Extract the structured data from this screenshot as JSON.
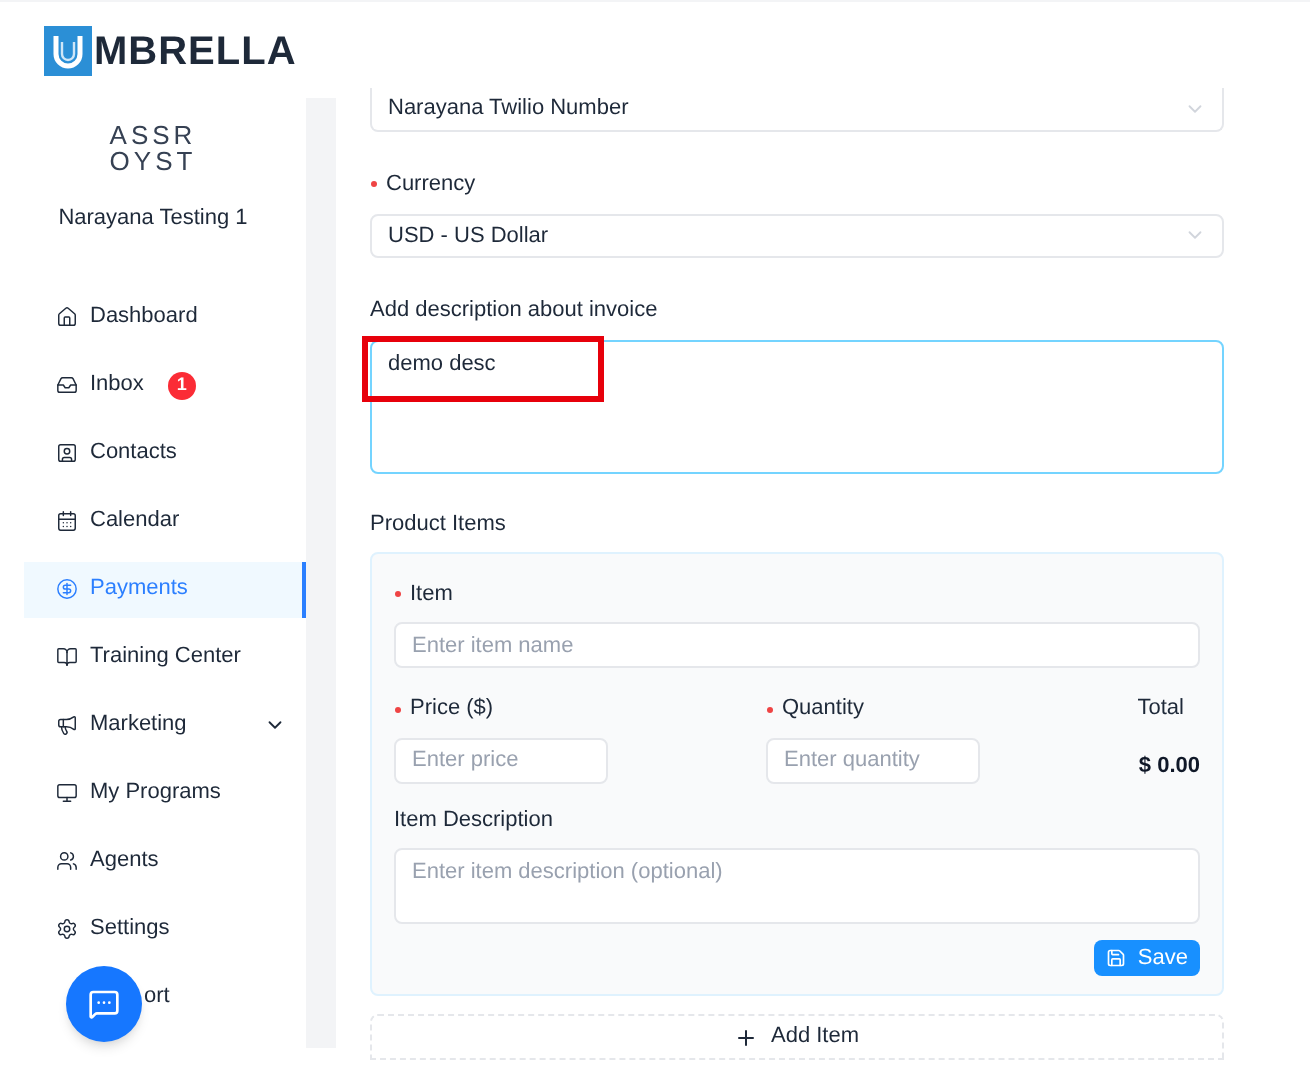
{
  "brand": {
    "name": "MBRELLA"
  },
  "account": {
    "logo_lines": [
      "ASSR",
      "OYST"
    ],
    "name": "Narayana Testing 1"
  },
  "sidebar": {
    "items": [
      {
        "label": "Dashboard",
        "kind": "link",
        "selected": false
      },
      {
        "label": "Inbox",
        "kind": "link",
        "selected": false,
        "badge": "1"
      },
      {
        "label": "Contacts",
        "kind": "link",
        "selected": false
      },
      {
        "label": "Calendar",
        "kind": "link",
        "selected": false
      },
      {
        "label": "Payments",
        "kind": "link",
        "selected": true
      },
      {
        "label": "Training Center",
        "kind": "link",
        "selected": false
      },
      {
        "label": "Marketing",
        "kind": "link",
        "selected": false,
        "expandable": true
      },
      {
        "label": "My Programs",
        "kind": "link",
        "selected": false
      },
      {
        "label": "Agents",
        "kind": "link",
        "selected": false
      },
      {
        "label": "Settings",
        "kind": "link",
        "selected": false
      },
      {
        "label": "ort",
        "kind": "covered",
        "selected": false
      }
    ]
  },
  "form": {
    "phone_select": {
      "value": "Narayana Twilio Number"
    },
    "currency": {
      "label": "Currency",
      "required": true,
      "value": "USD - US Dollar"
    },
    "description": {
      "label": "Add description about invoice",
      "value": "demo desc",
      "highlighted": true
    },
    "product_items": {
      "title": "Product Items",
      "item": {
        "label": "Item",
        "required": true,
        "placeholder": "Enter item name"
      },
      "price": {
        "label": "Price ($)",
        "required": true,
        "placeholder": "Enter price"
      },
      "quantity": {
        "label": "Quantity",
        "required": true,
        "placeholder": "Enter quantity"
      },
      "total": {
        "label": "Total",
        "value": "$ 0.00"
      },
      "item_description": {
        "label": "Item Description",
        "placeholder": "Enter item description (optional)"
      },
      "save_button": "Save"
    },
    "add_item_button": "Add Item"
  }
}
